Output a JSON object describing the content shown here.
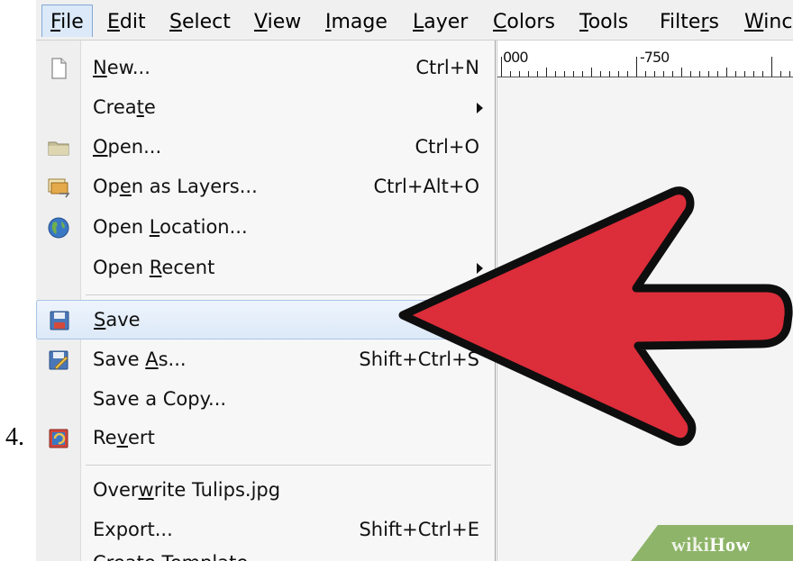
{
  "step_number": "4.",
  "menubar": {
    "items": [
      {
        "label": "File",
        "u": "F",
        "rest": "ile"
      },
      {
        "label": "Edit",
        "u": "E",
        "rest": "dit"
      },
      {
        "label": "Select",
        "u": "S",
        "rest": "elect"
      },
      {
        "label": "View",
        "u": "V",
        "rest": "iew"
      },
      {
        "label": "Image",
        "u": "I",
        "rest": "mage"
      },
      {
        "label": "Layer",
        "u": "L",
        "rest": "ayer"
      },
      {
        "label": "Colors",
        "u": "C",
        "rest": "olors"
      },
      {
        "label": "Tools",
        "u": "T",
        "rest": "ools"
      },
      {
        "label": "Filters",
        "pre": "Filte",
        "u": "r",
        "rest": "s"
      },
      {
        "label": "Winc",
        "u": "W",
        "rest": "inc"
      }
    ]
  },
  "ruler": {
    "labels": [
      "000",
      "-750"
    ]
  },
  "file_menu": {
    "new": {
      "pre": "",
      "u": "N",
      "post": "ew...",
      "shortcut": "Ctrl+N"
    },
    "create": {
      "pre": "Crea",
      "u": "t",
      "post": "e"
    },
    "open": {
      "pre": "",
      "u": "O",
      "post": "pen...",
      "shortcut": "Ctrl+O"
    },
    "open_as_layers": {
      "pre": "Op",
      "u": "e",
      "post": "n as Layers...",
      "shortcut": "Ctrl+Alt+O"
    },
    "open_location": {
      "pre": "Open ",
      "u": "L",
      "post": "ocation..."
    },
    "open_recent": {
      "pre": "Open ",
      "u": "R",
      "post": "ecent"
    },
    "save": {
      "pre": "",
      "u": "S",
      "post": "ave"
    },
    "save_as": {
      "pre": "Save ",
      "u": "A",
      "post": "s...",
      "shortcut": "Shift+Ctrl+S"
    },
    "save_a_copy": {
      "label": "Save a Copy..."
    },
    "revert": {
      "pre": "Re",
      "u": "v",
      "post": "ert"
    },
    "overwrite": {
      "pre": "Over",
      "u": "w",
      "post": "rite Tulips.jpg"
    },
    "export": {
      "label": "Export...",
      "shortcut": "Shift+Ctrl+E"
    },
    "create_template": {
      "label": "Create Template..."
    }
  },
  "icons": {
    "new": "new-document-icon",
    "open": "folder-icon",
    "open_as_layers": "open-layers-icon",
    "open_location": "globe-icon",
    "save": "floppy-disk-icon",
    "save_as": "save-as-icon",
    "revert": "revert-icon"
  },
  "colors": {
    "arrow": "#dc2d3a",
    "highlight": "#dce9f8",
    "watermark": "#8db468"
  },
  "watermark": {
    "part1": "wiki",
    "part2": "How"
  }
}
